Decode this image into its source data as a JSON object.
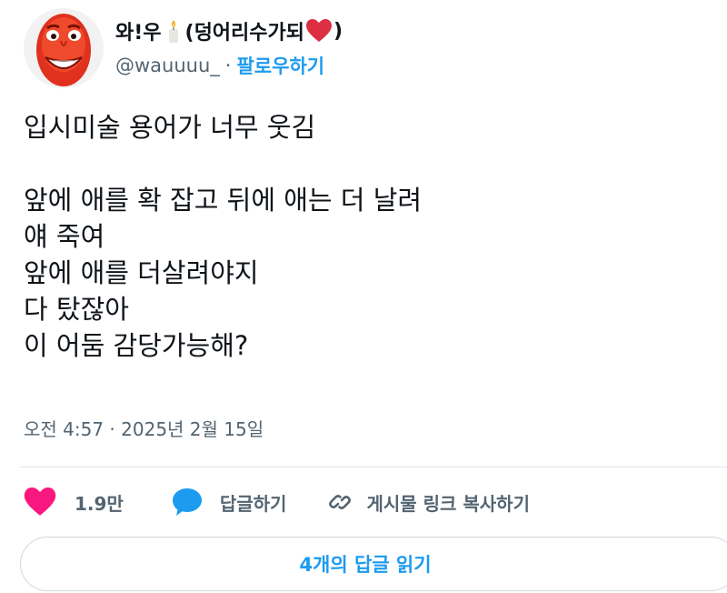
{
  "author": {
    "display_name_prefix": "와!우",
    "display_name_suffix": "(덩어리수가되",
    "display_name_close": ")",
    "handle": "@wauuuu_",
    "separator": "·",
    "follow_label": "팔로우하기"
  },
  "tweet": {
    "lines": [
      "입시미술 용어가 너무 웃김",
      "",
      "앞에 애를 확 잡고 뒤에 애는 더 날려",
      "얘 죽여",
      "앞에 애를 더살려야지",
      "다 탔잖아",
      "이 어둠 감당가능해?"
    ],
    "timestamp": "오전 4:57 · 2025년 2월 15일"
  },
  "actions": {
    "like_count": "1.9만",
    "reply_label": "답글하기",
    "share_label": "게시물 링크 복사하기"
  },
  "read_replies_label": "4개의 답글 읽기",
  "colors": {
    "accent": "#1d9bf0",
    "like": "#f91880",
    "secondary_text": "#536471",
    "primary_text": "#0f1419",
    "border": "#cfd9de"
  },
  "icons": {
    "avatar": "red-face-avatar",
    "candle": "candle-icon",
    "heart_emoji": "red-heart-icon",
    "like": "heart-icon",
    "reply": "speech-bubble-icon",
    "share": "link-icon"
  }
}
